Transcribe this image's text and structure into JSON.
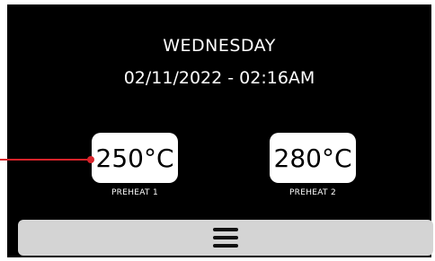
{
  "header": {
    "day": "WEDNESDAY",
    "datetime": "02/11/2022 - 02:16AM"
  },
  "presets": [
    {
      "temperature": "250°C",
      "label": "PREHEAT 1"
    },
    {
      "temperature": "280°C",
      "label": "PREHEAT 2"
    }
  ],
  "menu": {
    "icon": "hamburger-menu-icon"
  },
  "colors": {
    "screen_background": "#000000",
    "tile_background": "#ffffff",
    "callout": "#d8232a",
    "menu_bar": "#d4d4d4"
  }
}
